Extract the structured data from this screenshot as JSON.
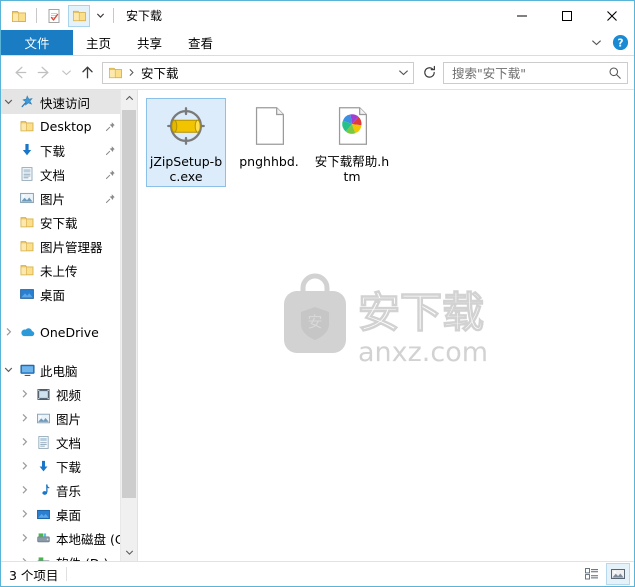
{
  "window": {
    "title": "安下载",
    "border_color": "#5ab4d8"
  },
  "quick_access_toolbar": {
    "buttons": [
      {
        "name": "properties-folder-icon",
        "label": "属性"
      },
      {
        "name": "new-folder-icon",
        "label": "新建文件夹"
      },
      {
        "name": "customize-folder-icon",
        "label": "自定义快速访问工具栏"
      }
    ]
  },
  "window_controls": {
    "minimize": "—",
    "maximize": "□",
    "close": "✕"
  },
  "ribbon": {
    "tabs": [
      {
        "label": "文件",
        "active": true
      },
      {
        "label": "主页",
        "active": false
      },
      {
        "label": "共享",
        "active": false
      },
      {
        "label": "查看",
        "active": false
      }
    ],
    "accent_color": "#1a7cc3",
    "collapse_label": "展开功能区",
    "help_label": "帮助"
  },
  "navigation": {
    "back_label": "后退",
    "forward_label": "前进",
    "recent_label": "最近浏览的位置",
    "up_label": "上移到上一级",
    "refresh_label": "刷新",
    "address": {
      "crumb": "安下载",
      "dropdown_label": "以前的位置"
    }
  },
  "search": {
    "placeholder": "搜索\"安下载\"",
    "icon": "search-icon"
  },
  "sidebar": {
    "groups": [
      {
        "name": "quick-access",
        "label": "快速访问",
        "icon": "star-pin-icon",
        "expanded": true,
        "highlighted": true,
        "items": [
          {
            "label": "Desktop",
            "icon": "folder-icon",
            "pinned": true
          },
          {
            "label": "下载",
            "icon": "download-icon",
            "pinned": true
          },
          {
            "label": "文档",
            "icon": "documents-icon",
            "pinned": true
          },
          {
            "label": "图片",
            "icon": "pictures-icon",
            "pinned": true
          },
          {
            "label": "安下载",
            "icon": "folder-icon",
            "pinned": false
          },
          {
            "label": "图片管理器",
            "icon": "folder-icon",
            "pinned": false
          },
          {
            "label": "未上传",
            "icon": "folder-icon",
            "pinned": false
          },
          {
            "label": "桌面",
            "icon": "desktop-icon",
            "pinned": false
          }
        ]
      },
      {
        "name": "onedrive",
        "label": "OneDrive",
        "icon": "cloud-icon",
        "expanded": false,
        "items": []
      },
      {
        "name": "this-pc",
        "label": "此电脑",
        "icon": "computer-icon",
        "expanded": true,
        "items": [
          {
            "label": "视频",
            "icon": "videos-icon",
            "expandable": true
          },
          {
            "label": "图片",
            "icon": "pictures-icon",
            "expandable": true
          },
          {
            "label": "文档",
            "icon": "documents-icon",
            "expandable": true
          },
          {
            "label": "下载",
            "icon": "download-icon",
            "expandable": true
          },
          {
            "label": "音乐",
            "icon": "music-icon",
            "expandable": true
          },
          {
            "label": "桌面",
            "icon": "desktop-icon",
            "expandable": true
          },
          {
            "label": "本地磁盘 (C",
            "icon": "drive-icon",
            "expandable": true
          },
          {
            "label": "软件 (D:)",
            "icon": "drive-icon",
            "expandable": true
          }
        ]
      }
    ],
    "scrollbar": {
      "up_label": "向上滚动",
      "down_label": "向下滚动"
    }
  },
  "files": {
    "items": [
      {
        "name": "jZipSetup-bc.exe",
        "icon": "installer-icon",
        "selected": true
      },
      {
        "name": "pnghhbd.",
        "icon": "blank-document-icon",
        "selected": false
      },
      {
        "name": "安下载帮助.htm",
        "icon": "html-document-icon",
        "selected": false
      }
    ]
  },
  "watermark": {
    "brand_char": "安",
    "brand_text": "安下载",
    "site": "anxz.com",
    "color": "#d2d2d2"
  },
  "statusbar": {
    "item_count": "3 个项目",
    "views": [
      {
        "name": "details-view-button",
        "label": "详细信息",
        "active": false
      },
      {
        "name": "large-icons-view-button",
        "label": "大图标",
        "active": true
      }
    ]
  }
}
